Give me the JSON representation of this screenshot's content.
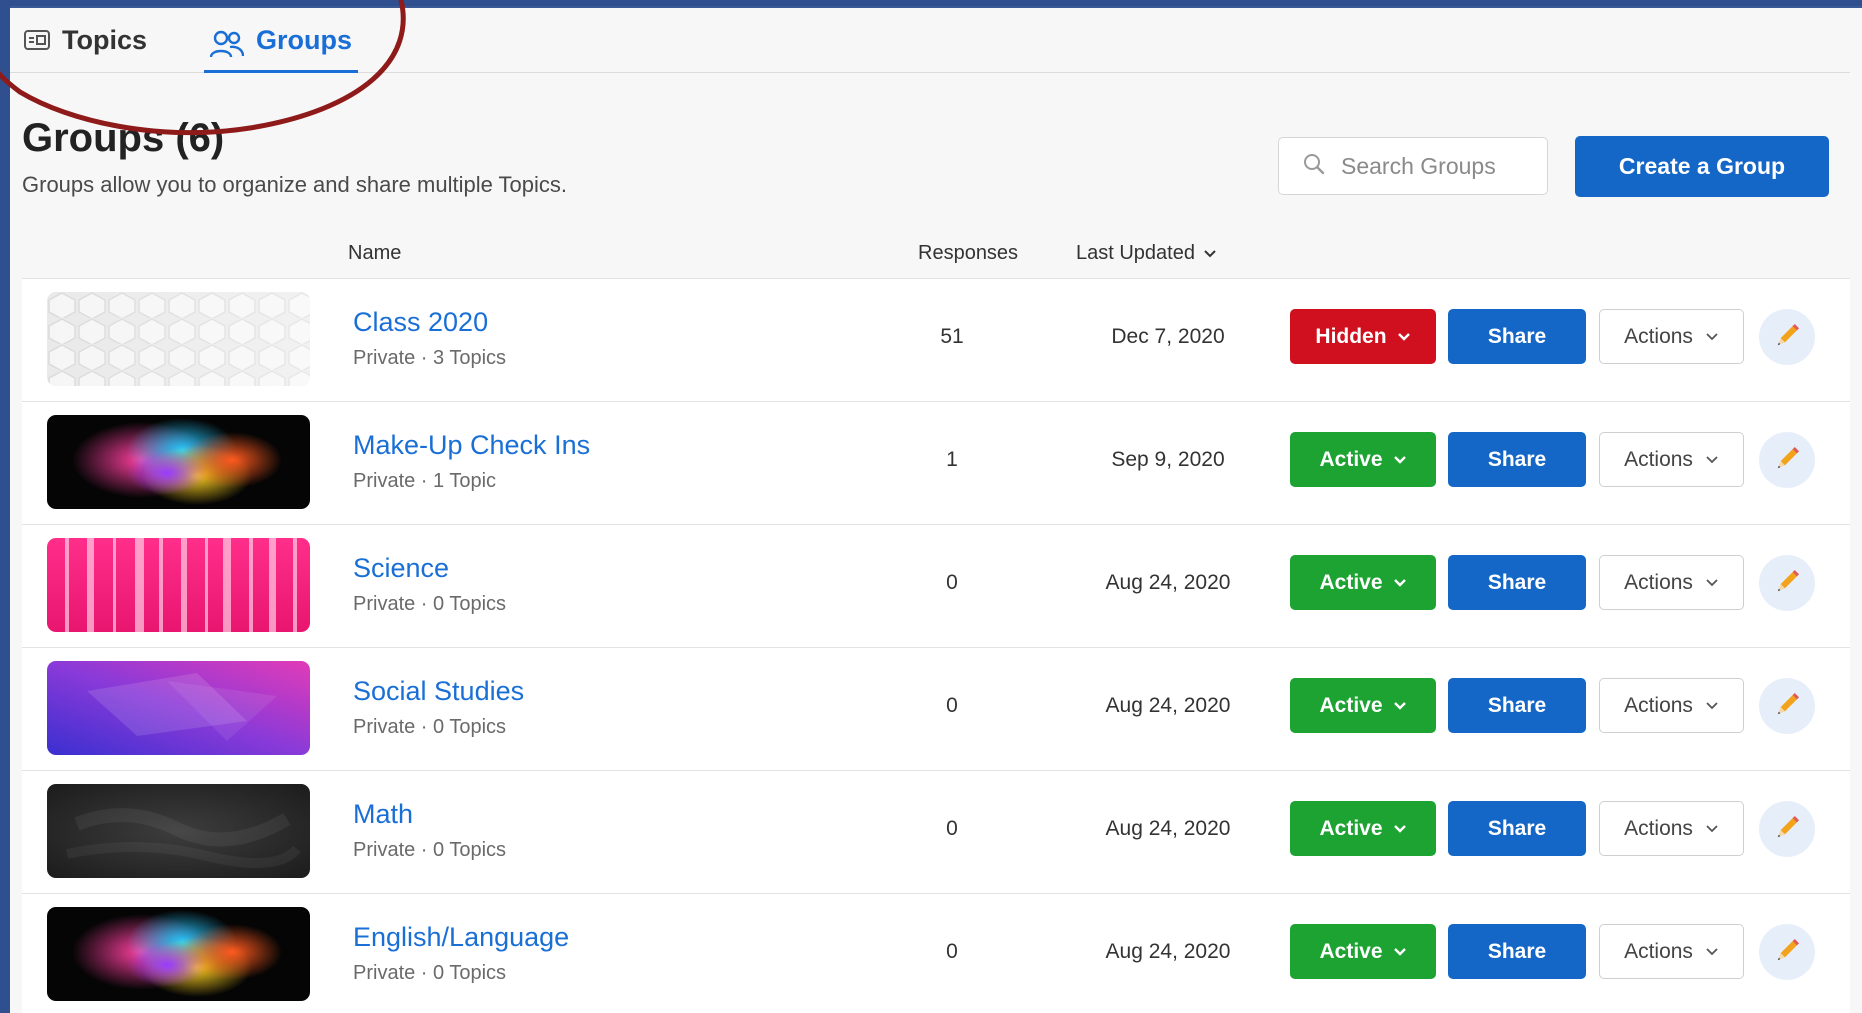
{
  "tabs": [
    {
      "label": "Topics",
      "icon": "topics-card-icon",
      "active": false
    },
    {
      "label": "Groups",
      "icon": "groups-people-icon",
      "active": true
    }
  ],
  "header": {
    "title": "Groups (6)",
    "subtitle": "Groups allow you to organize and share multiple Topics.",
    "search_placeholder": "Search Groups",
    "create_label": "Create a Group"
  },
  "table": {
    "columns": {
      "name": "Name",
      "responses": "Responses",
      "updated": "Last Updated"
    },
    "rows": [
      {
        "title": "Class 2020",
        "meta": "Private · 3 Topics",
        "responses": "51",
        "updated": "Dec 7, 2020",
        "status": "Hidden",
        "share": "Share",
        "actions": "Actions",
        "thumb": "white-hexagons"
      },
      {
        "title": "Make-Up Check Ins",
        "meta": "Private · 1 Topic",
        "responses": "1",
        "updated": "Sep 9, 2020",
        "status": "Active",
        "share": "Share",
        "actions": "Actions",
        "thumb": "color-powder-explosion"
      },
      {
        "title": "Science",
        "meta": "Private · 0 Topics",
        "responses": "0",
        "updated": "Aug 24, 2020",
        "status": "Active",
        "share": "Share",
        "actions": "Actions",
        "thumb": "pink-light-streaks"
      },
      {
        "title": "Social Studies",
        "meta": "Private · 0 Topics",
        "responses": "0",
        "updated": "Aug 24, 2020",
        "status": "Active",
        "share": "Share",
        "actions": "Actions",
        "thumb": "purple-gradient"
      },
      {
        "title": "Math",
        "meta": "Private · 0 Topics",
        "responses": "0",
        "updated": "Aug 24, 2020",
        "status": "Active",
        "share": "Share",
        "actions": "Actions",
        "thumb": "chalkboard"
      },
      {
        "title": "English/Language",
        "meta": "Private · 0 Topics",
        "responses": "0",
        "updated": "Aug 24, 2020",
        "status": "Active",
        "share": "Share",
        "actions": "Actions",
        "thumb": "color-powder-explosion"
      }
    ]
  },
  "colors": {
    "brand_blue": "#1467c7",
    "link_blue": "#1a6fd6",
    "hidden_red": "#d0101f",
    "active_green": "#1ca332",
    "annotation_red": "#8e1a1a"
  }
}
